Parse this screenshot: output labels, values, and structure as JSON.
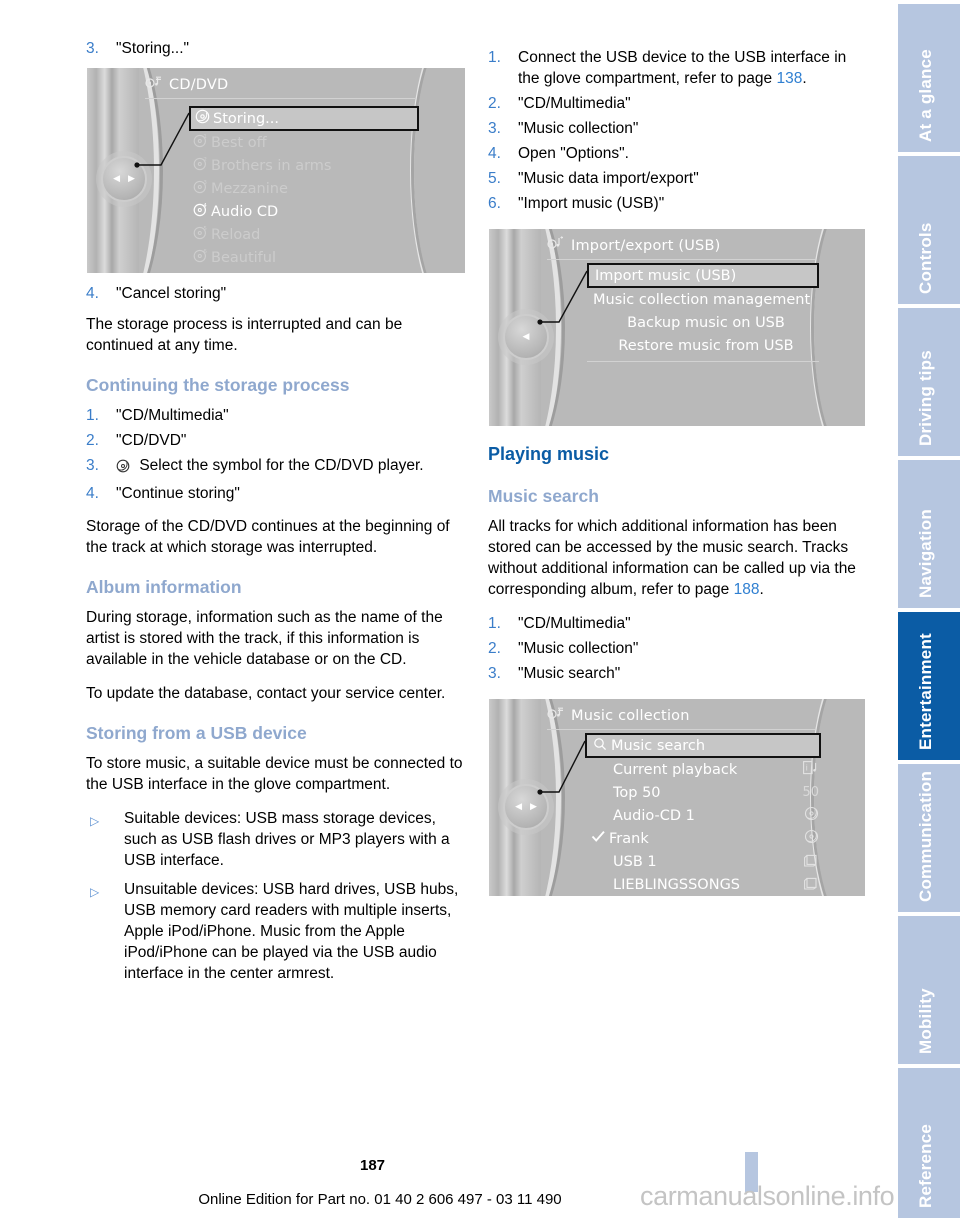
{
  "page": {
    "number": "187",
    "online_edition": "Online Edition for Part no. 01 40 2 606 497 - 03 11 490",
    "watermark": "carmanualsonline.info"
  },
  "sidebar": {
    "tabs": [
      {
        "label": "At a glance",
        "active": false
      },
      {
        "label": "Controls",
        "active": false
      },
      {
        "label": "Driving tips",
        "active": false
      },
      {
        "label": "Navigation",
        "active": false
      },
      {
        "label": "Entertainment",
        "active": true
      },
      {
        "label": "Communication",
        "active": false
      },
      {
        "label": "Mobility",
        "active": false
      },
      {
        "label": "Reference",
        "active": false
      }
    ],
    "colors": {
      "inactive": "#b6c6e0",
      "active": "#0b5ca5",
      "label": "#ffffff"
    }
  },
  "colors": {
    "step_number": "#3a7dc9",
    "subheading": "#8fa8ce",
    "heading": "#0b5ca5",
    "page_reference": "#2f7fd1"
  },
  "left_column": {
    "step_storing": {
      "num": "3.",
      "text": "\"Storing...\""
    },
    "screen_cd_dvd": {
      "title": "CD/DVD",
      "title_icon": "multimedia-icon",
      "rows": [
        {
          "icon": "cd-icon",
          "label": "Storing...",
          "state": "selected"
        },
        {
          "icon": "cd1-icon",
          "label": "Best off",
          "state": "dim"
        },
        {
          "icon": "cd2-icon",
          "label": "Brothers in arms",
          "state": "dim"
        },
        {
          "icon": "cd3-icon",
          "label": "Mezzanine",
          "state": "dim"
        },
        {
          "icon": "cd4-icon",
          "label": "Audio CD",
          "state": "bright"
        },
        {
          "icon": "cd5-icon",
          "label": "Reload",
          "state": "dim"
        },
        {
          "icon": "cd6-icon",
          "label": "Beautiful",
          "state": "dim"
        }
      ]
    },
    "step_cancel": {
      "num": "4.",
      "text": "\"Cancel storing\""
    },
    "para_interrupted": "The storage process is interrupted and can be continued at any time.",
    "heading_continuing": "Continuing the storage process",
    "steps_continuing": [
      {
        "num": "1.",
        "text": "\"CD/Multimedia\""
      },
      {
        "num": "2.",
        "text": "\"CD/DVD\""
      },
      {
        "num": "3.",
        "text": "Select the symbol for the CD/DVD player.",
        "icon": "cd-icon"
      },
      {
        "num": "4.",
        "text": "\"Continue storing\""
      }
    ],
    "para_storage_continues": "Storage of the CD/DVD continues at the beginning of the track at which storage was interrupted.",
    "heading_album_info": "Album information",
    "para_album_1": "During storage, information such as the name of the artist is stored with the track, if this information is available in the vehicle database or on the CD.",
    "para_album_2": "To update the database, contact your service center.",
    "heading_storing_usb": "Storing from a USB device",
    "para_usb_intro": "To store music, a suitable device must be connected to the USB interface in the glove compartment.",
    "bullets_usb": [
      "Suitable devices: USB mass storage devices, such as USB flash drives or MP3 players with a USB interface.",
      "Unsuitable devices: USB hard drives, USB hubs, USB memory card readers with multiple inserts, Apple iPod/iPhone. Music from the Apple iPod/iPhone can be played via the USB audio interface in the center armrest."
    ]
  },
  "right_column": {
    "steps_usb_import": [
      {
        "num": "1.",
        "text_before": "Connect the USB device to the USB interface in the glove compartment, refer to page ",
        "page_ref": "138",
        "text_after": "."
      },
      {
        "num": "2.",
        "text": "\"CD/Multimedia\""
      },
      {
        "num": "3.",
        "text": "\"Music collection\""
      },
      {
        "num": "4.",
        "text": "Open \"Options\"."
      },
      {
        "num": "5.",
        "text": "\"Music data import/export\""
      },
      {
        "num": "6.",
        "text": "\"Import music (USB)\""
      }
    ],
    "screen_import_export": {
      "title": "Import/export (USB)",
      "title_icon": "import-export-icon",
      "rows": [
        {
          "label": "Import music (USB)",
          "state": "selected"
        },
        {
          "label": "Music collection management",
          "state": "bright"
        },
        {
          "label": "Backup music on USB",
          "state": "bright"
        },
        {
          "label": "Restore music from USB",
          "state": "bright"
        }
      ]
    },
    "heading_playing_music": "Playing music",
    "heading_music_search": "Music search",
    "para_music_search_before": "All tracks for which additional information has been stored can be accessed by the music search. Tracks without additional information can be called up via the corresponding album, refer to page ",
    "para_music_search_ref": "188",
    "para_music_search_after": ".",
    "steps_music_search": [
      {
        "num": "1.",
        "text": "\"CD/Multimedia\""
      },
      {
        "num": "2.",
        "text": "\"Music collection\""
      },
      {
        "num": "3.",
        "text": "\"Music search\""
      }
    ],
    "screen_music_collection": {
      "title": "Music collection",
      "title_icon": "multimedia-icon",
      "rows": [
        {
          "icon": "search-icon",
          "label": "Music search",
          "right": "",
          "state": "selected"
        },
        {
          "icon": "",
          "label": "Current playback",
          "right": "info-note-icon",
          "state": "bright"
        },
        {
          "icon": "",
          "label": "Top 50",
          "right": "50",
          "state": "bright"
        },
        {
          "icon": "",
          "label": "Audio-CD 1",
          "right": "cd-icon",
          "state": "bright"
        },
        {
          "icon": "check-icon",
          "label": "Frank",
          "right": "cd-icon",
          "state": "bright"
        },
        {
          "icon": "",
          "label": "USB 1",
          "right": "folder-icon",
          "state": "bright"
        },
        {
          "icon": "",
          "label": "LIEBLINGSSONGS",
          "right": "folder-icon",
          "state": "bright"
        }
      ]
    }
  }
}
